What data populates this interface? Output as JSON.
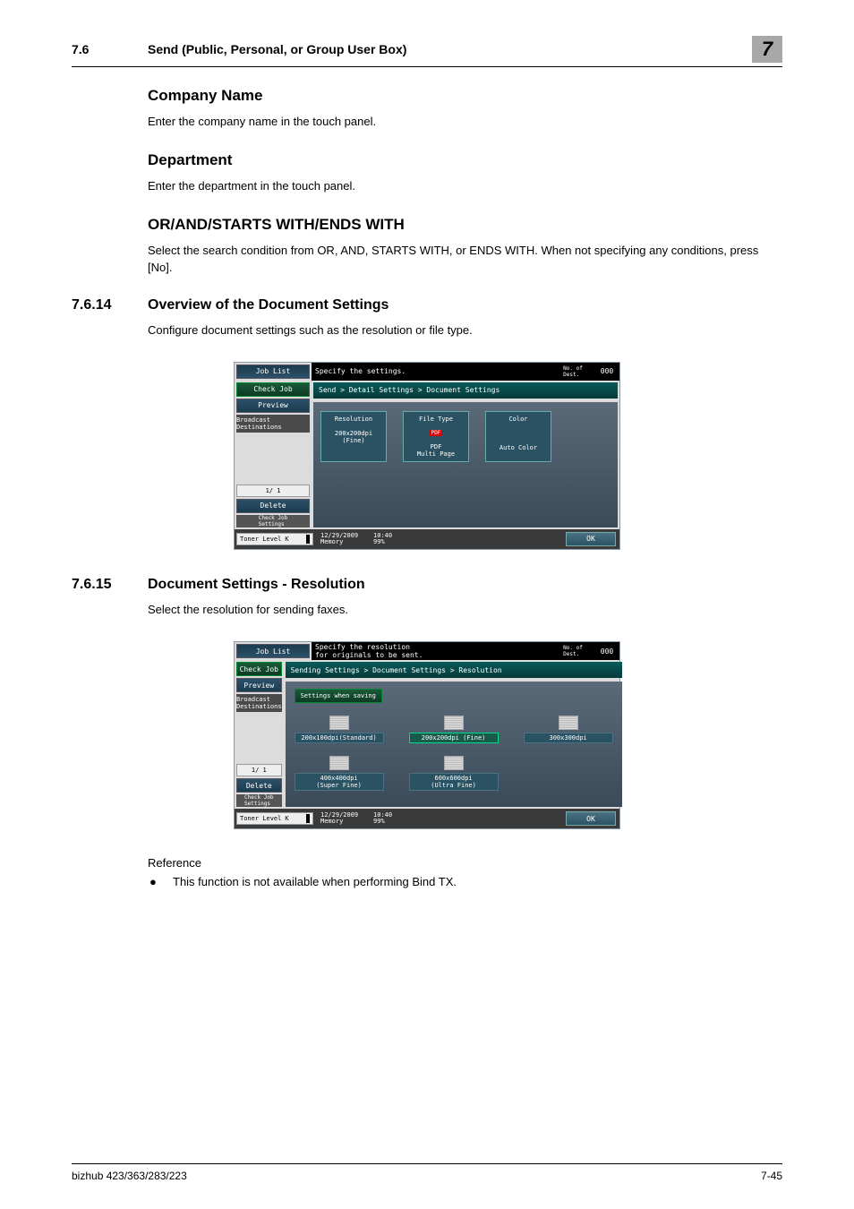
{
  "header": {
    "section_num": "7.6",
    "section_title": "Send (Public, Personal, or Group User Box)",
    "chapter": "7"
  },
  "sec1": {
    "heading": "Company Name",
    "body": "Enter the company name in the touch panel."
  },
  "sec2": {
    "heading": "Department",
    "body": "Enter the department in the touch panel."
  },
  "sec3": {
    "heading": "OR/AND/STARTS WITH/ENDS WITH",
    "body": "Select the search condition from OR, AND, STARTS WITH, or ENDS WITH. When not specifying any conditions, press [No]."
  },
  "sub1": {
    "num": "7.6.14",
    "title": "Overview of the Document Settings",
    "body": "Configure document settings such as the resolution or file type."
  },
  "sub2": {
    "num": "7.6.15",
    "title": "Document Settings - Resolution",
    "body": "Select the resolution for sending faxes."
  },
  "reference": {
    "label": "Reference",
    "bullet": "This function is not available when performing Bind TX."
  },
  "footer": {
    "left": "bizhub 423/363/283/223",
    "right": "7-45"
  },
  "panel_common": {
    "job_list": "Job List",
    "check_job": "Check Job",
    "preview": "Preview",
    "broadcast": "Broadcast\nDestinations",
    "page": "1/   1",
    "delete": "Delete",
    "check_job_settings": "Check Job\nSettings",
    "toner": "Toner Level",
    "date": "12/29/2009",
    "time": "10:40",
    "memory_lbl": "Memory",
    "memory_val": "99%",
    "dest_lbl": "No. of\nDest.",
    "dest_count": "000",
    "ok": "OK",
    "k": "K"
  },
  "panel1": {
    "specify": "Specify the settings.",
    "crumb": "Send > Detail Settings > Document Settings",
    "tiles": {
      "resolution_head": "Resolution",
      "resolution_val": "200x200dpi\n(Fine)",
      "filetype_head": "File Type",
      "filetype_chip": "PDF",
      "filetype_val": "PDF\nMulti Page",
      "color_head": "Color",
      "color_val": "Auto Color"
    }
  },
  "panel2": {
    "specify": "Specify the resolution\nfor originals to be sent.",
    "crumb": "Sending Settings > Document Settings > Resolution",
    "settings_when_saving": "Settings when saving",
    "res": {
      "a": "200x100dpi(Standard)",
      "b": "200x200dpi (Fine)",
      "c": "300x300dpi",
      "d": "400x400dpi\n(Super Fine)",
      "e": "600x600dpi\n(Ultra Fine)"
    }
  }
}
